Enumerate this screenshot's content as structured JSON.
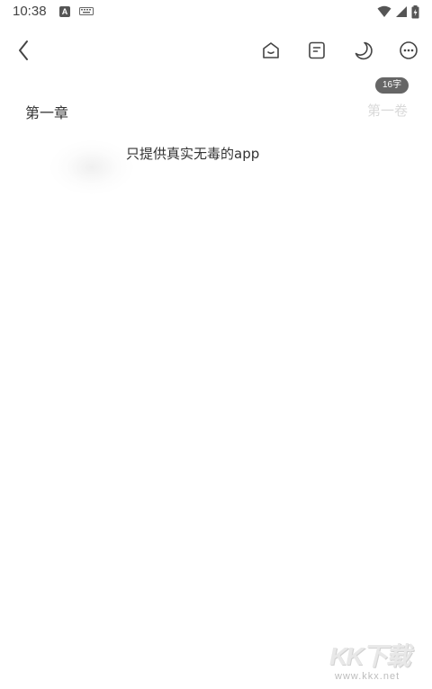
{
  "status_bar": {
    "time": "10:38",
    "notification_letter": "A"
  },
  "toolbar": {
    "icons": [
      "back-icon",
      "bookshelf-icon",
      "outline-icon",
      "night-mode-icon",
      "more-icon"
    ]
  },
  "editor": {
    "word_count_badge": "16字",
    "chapter_title": "第一章",
    "volume_label": "第一卷",
    "body_text": "只提供真实无毒的app"
  },
  "watermark": {
    "logo_text": "KK下载",
    "url": "www.kkx.net"
  }
}
